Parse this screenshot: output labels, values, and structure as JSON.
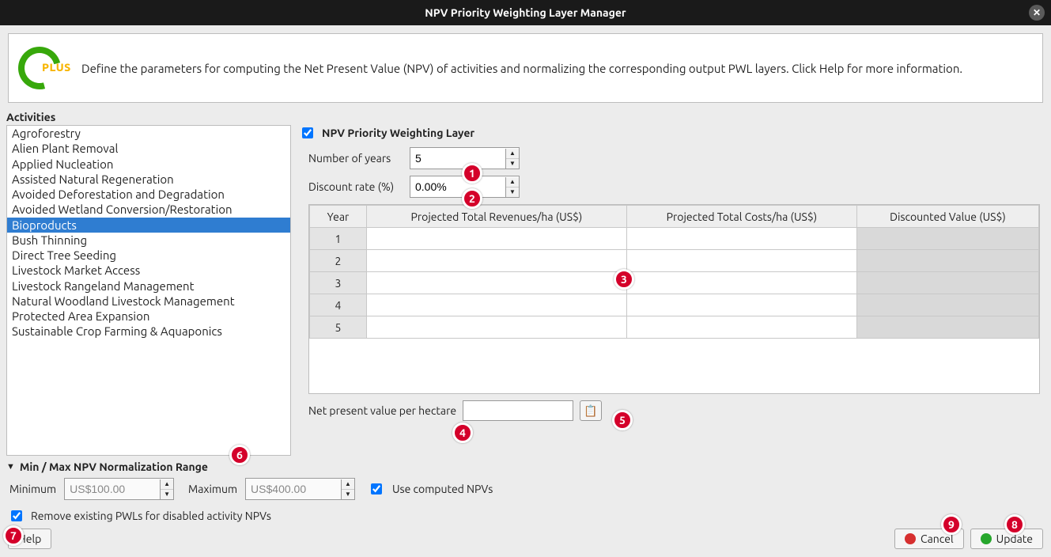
{
  "window": {
    "title": "NPV Priority Weighting Layer Manager"
  },
  "intro": {
    "logo_text": "PLUS",
    "description": "Define the parameters for computing the Net Present Value (NPV) of activities and normalizing the corresponding output PWL layers. Click Help for more information."
  },
  "sections": {
    "activities_label": "Activities",
    "npv_checkbox_label": "NPV Priority Weighting Layer",
    "num_years_label": "Number of years",
    "discount_label": "Discount rate (%)",
    "npv_per_ha_label": "Net present value per hectare",
    "normalization_header": "Min / Max NPV Normalization Range",
    "min_label": "Minimum",
    "max_label": "Maximum",
    "use_computed_label": "Use computed NPVs",
    "remove_pwl_label": "Remove existing PWLs for disabled activity NPVs"
  },
  "activities": [
    "Agroforestry",
    "Alien Plant Removal",
    "Applied Nucleation",
    "Assisted Natural Regeneration",
    "Avoided Deforestation and Degradation",
    "Avoided Wetland Conversion/Restoration",
    "Bioproducts",
    "Bush Thinning",
    "Direct Tree Seeding",
    "Livestock Market Access",
    "Livestock Rangeland Management",
    "Natural Woodland Livestock Management",
    "Protected Area Expansion",
    "Sustainable Crop Farming & Aquaponics"
  ],
  "activities_selected_index": 6,
  "form": {
    "npv_enabled": true,
    "num_years": "5",
    "discount_rate": "0.00%",
    "npv_per_ha": "",
    "min_value": "US$100.00",
    "max_value": "US$400.00",
    "use_computed": true,
    "remove_pwls": true
  },
  "table": {
    "headers": {
      "year": "Year",
      "rev": "Projected Total Revenues/ha (US$)",
      "cost": "Projected Total Costs/ha (US$)",
      "dv": "Discounted Value (US$)"
    },
    "rows": [
      {
        "year": "1",
        "rev": "",
        "cost": "",
        "dv": ""
      },
      {
        "year": "2",
        "rev": "",
        "cost": "",
        "dv": ""
      },
      {
        "year": "3",
        "rev": "",
        "cost": "",
        "dv": ""
      },
      {
        "year": "4",
        "rev": "",
        "cost": "",
        "dv": ""
      },
      {
        "year": "5",
        "rev": "",
        "cost": "",
        "dv": ""
      }
    ]
  },
  "buttons": {
    "help": "Help",
    "cancel": "Cancel",
    "update": "Update"
  },
  "icons": {
    "copy": "📋"
  },
  "markers": [
    "1",
    "2",
    "3",
    "4",
    "5",
    "6",
    "7",
    "8",
    "9"
  ]
}
